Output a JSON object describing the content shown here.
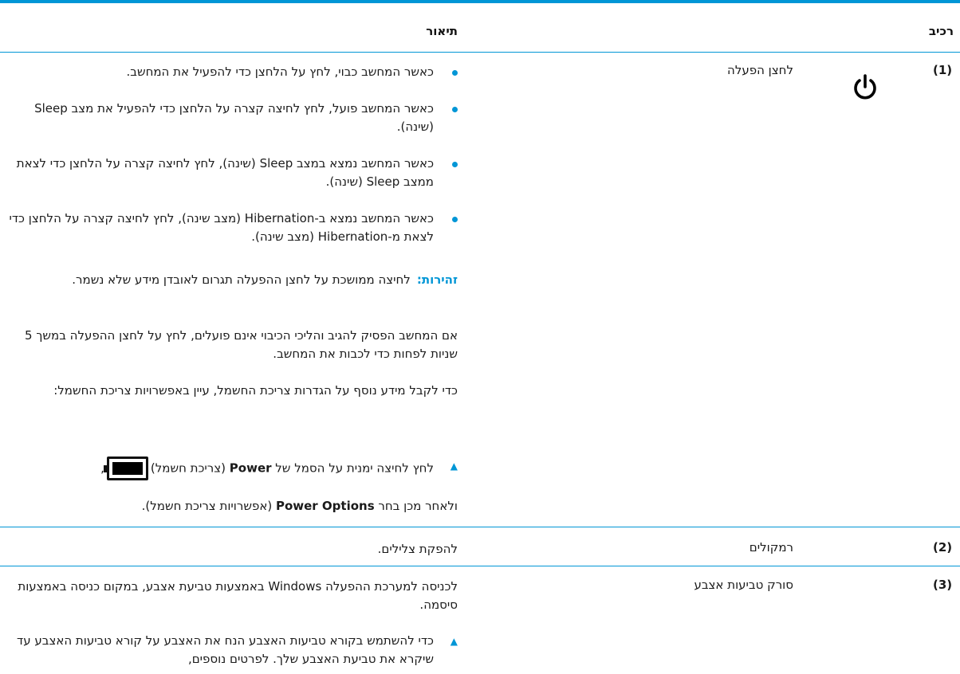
{
  "header": {
    "component": "רכיב",
    "description": "תיאור"
  },
  "rows": [
    {
      "number": "(1)",
      "name": "לחצן הפעלה",
      "icon": "power-icon",
      "bullets": [
        "כאשר המחשב כבוי, לחץ על הלחצן כדי להפעיל את המחשב.",
        "כאשר המחשב פועל, לחץ לחיצה קצרה על הלחצן כדי להפעיל את מצב Sleep (שינה).",
        "כאשר המחשב נמצא במצב Sleep (שינה), לחץ לחיצה קצרה על הלחצן כדי לצאת ממצב Sleep (שינה).",
        "כאשר המחשב נמצא ב-Hibernation (מצב שינה), לחץ לחיצה קצרה על הלחצן כדי לצאת מ-Hibernation (מצב שינה)."
      ],
      "warning_label": "זהירות:",
      "warning_text": "לחיצה ממושכת על לחצן ההפעלה תגרום לאובדן מידע שלא נשמר.",
      "para1": "אם המחשב הפסיק להגיב והליכי הכיבוי אינם פועלים, לחץ על לחצן ההפעלה במשך 5 שניות לפחות כדי לכבות את המחשב.",
      "para2": "כדי לקבל מידע נוסף על הגדרות צריכת החשמל, עיין באפשרויות צריכת החשמל:",
      "step_pre": "לחץ לחיצה ימנית על הסמל של ",
      "step_bold": "Power",
      "step_post": " (צריכת חשמל)",
      "step_comma": ",",
      "step2_pre": "ולאחר מכן בחר ",
      "step2_bold": "Power Options",
      "step2_post": " (אפשרויות צריכת חשמל)."
    },
    {
      "number": "(2)",
      "name": "רמקולים",
      "description": "להפקת צלילים."
    },
    {
      "number": "(3)",
      "name": "סורק טביעות אצבע",
      "description": "לכניסה למערכת ההפעלה Windows באמצעות טביעת אצבע, במקום כניסה באמצעות סיסמה.",
      "step": "כדי להשתמש בקורא טביעות האצבע הנח את האצבע על קורא טביעות האצבע עד שיקרא את טביעת האצבע שלך. לפרטים נוספים,"
    }
  ],
  "colors": {
    "accent": "#0096d6"
  }
}
